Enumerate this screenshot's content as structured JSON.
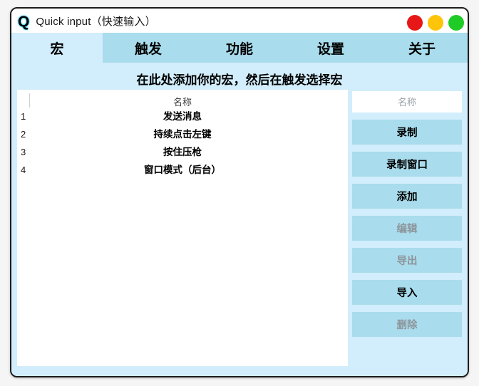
{
  "window": {
    "logo_letter": "Q",
    "title": "Quick input（快速输入）",
    "traffic_lights": [
      {
        "name": "close",
        "color": "#e81717"
      },
      {
        "name": "minimize",
        "color": "#fdc40a"
      },
      {
        "name": "maximize",
        "color": "#1fcb25"
      }
    ]
  },
  "tabs": [
    {
      "label": "宏",
      "selected": true
    },
    {
      "label": "触发",
      "selected": false
    },
    {
      "label": "功能",
      "selected": false
    },
    {
      "label": "设置",
      "selected": false
    },
    {
      "label": "关于",
      "selected": false
    }
  ],
  "content": {
    "hint": "在此处添加你的宏，然后在触发选择宏",
    "list": {
      "column_header": "名称",
      "rows": [
        {
          "index": "1",
          "name": "发送消息"
        },
        {
          "index": "2",
          "name": "持续点击左键"
        },
        {
          "index": "3",
          "name": "按住压枪"
        },
        {
          "index": "4",
          "name": "窗口模式（后台）"
        }
      ]
    },
    "sidebar": {
      "name_placeholder": "名称",
      "buttons": [
        {
          "label": "录制",
          "enabled": true
        },
        {
          "label": "录制窗口",
          "enabled": true
        },
        {
          "label": "添加",
          "enabled": true
        },
        {
          "label": "编辑",
          "enabled": false
        },
        {
          "label": "导出",
          "enabled": false
        },
        {
          "label": "导入",
          "enabled": true
        },
        {
          "label": "删除",
          "enabled": false
        }
      ]
    }
  },
  "colors": {
    "accent_light": "#d2edfb",
    "accent_mid": "#a9dcec",
    "window_border": "#1c1c1c",
    "logo_cyan": "#1ec8ec",
    "disabled_text": "#8d959c"
  }
}
